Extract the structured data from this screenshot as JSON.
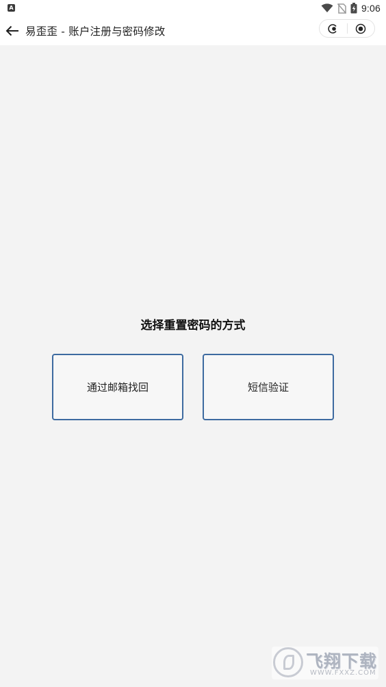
{
  "status_bar": {
    "app_icon": "A",
    "time": "9:06",
    "icons": [
      "wifi-icon",
      "no-sim-icon",
      "battery-charging-icon"
    ]
  },
  "nav": {
    "back_icon": "arrow-left-icon",
    "title": "易歪歪 - 账户注册与密码修改",
    "capsule_icons": [
      "more-dots-icon",
      "close-target-icon"
    ]
  },
  "main": {
    "prompt": "选择重置密码的方式",
    "options": [
      {
        "label": "通过邮箱找回"
      },
      {
        "label": "短信验证"
      }
    ],
    "accent_color": "#3d6aa0"
  },
  "watermark": {
    "text": "飞翔下载",
    "url": "WWW.FXXZ.COM"
  }
}
